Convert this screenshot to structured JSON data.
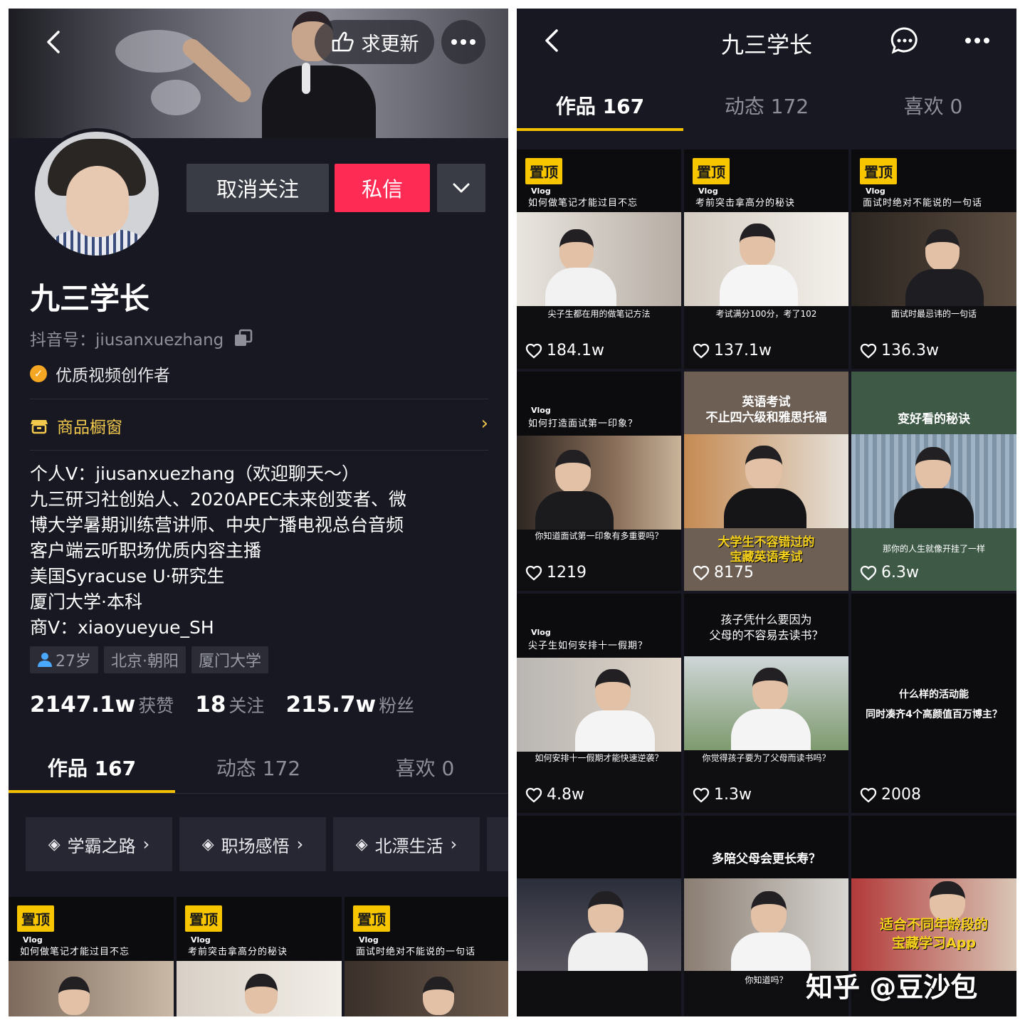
{
  "left": {
    "header": {
      "request_update_label": "求更新"
    },
    "buttons": {
      "unfollow": "取消关注",
      "message": "私信"
    },
    "profile": {
      "name": "九三学长",
      "douyin_id": "抖音号：jiusanxuezhang",
      "badge": "优质视频创作者",
      "shop_window": "商品橱窗",
      "bio": [
        "个人V：jiusanxuezhang（欢迎聊天～）",
        "九三研习社创始人、2020APEC未来创变者、微",
        "博大学暑期训练营讲师、中央广播电视总台音频",
        "客户端云听职场优质内容主播",
        "美国Syracuse U·研究生",
        "厦门大学·本科",
        "商V：xiaoyueyue_SH"
      ],
      "tags": [
        "27岁",
        "北京·朝阳",
        "厦门大学"
      ],
      "stats": [
        {
          "value": "2147.1w",
          "label": "获赞"
        },
        {
          "value": "18",
          "label": "关注"
        },
        {
          "value": "215.7w",
          "label": "粉丝"
        }
      ]
    },
    "tabs": [
      "作品 167",
      "动态 172",
      "喜欢 0"
    ],
    "collections": [
      "学霸之路",
      "职场感悟",
      "北漂生活"
    ],
    "videos": [
      {
        "pin": "置顶",
        "vlog": "Vlog",
        "title": "如何做笔记才能过目不忘"
      },
      {
        "pin": "置顶",
        "vlog": "Vlog",
        "title": "考前突击拿高分的秘诀"
      },
      {
        "pin": "置顶",
        "vlog": "Vlog",
        "title": "面试时绝对不能说的一句话"
      }
    ]
  },
  "right": {
    "header": {
      "title": "九三学长"
    },
    "tabs": [
      "作品 167",
      "动态 172",
      "喜欢 0"
    ],
    "videos": [
      {
        "pin": "置顶",
        "vlog": "Vlog",
        "title": "如何做笔记才能过目不忘",
        "caption": "尖子生都在用的做笔记方法",
        "likes": "184.1w"
      },
      {
        "pin": "置顶",
        "vlog": "Vlog",
        "title": "考前突击拿高分的秘诀",
        "caption": "考试满分100分，考了102",
        "likes": "137.1w"
      },
      {
        "pin": "置顶",
        "vlog": "Vlog",
        "title": "面试时绝对不能说的一句话",
        "caption": "面试时最忌讳的一句话",
        "likes": "136.3w"
      },
      {
        "vlog": "Vlog",
        "title": "如何打造面试第一印象？",
        "caption": "你知道面试第一印象有多重要吗？",
        "likes": "1219"
      },
      {
        "headline": [
          "英语考试",
          "不止四六级和雅思托福"
        ],
        "yellow": [
          "大学生不容错过的",
          "宝藏英语考试"
        ],
        "likes": "8175"
      },
      {
        "headline": [
          "变好看的秘诀"
        ],
        "caption": "那你的人生就像开挂了一样",
        "likes": "6.3w"
      },
      {
        "vlog": "Vlog",
        "title": "尖子生如何安排十一假期？",
        "caption": "如何安排十一假期才能快速逆袭？",
        "likes": "4.8w"
      },
      {
        "headline": [
          "孩子凭什么要因为",
          "父母的不容易去读书？"
        ],
        "caption": "你觉得孩子要为了父母而读书吗？",
        "likes": "1.3w"
      },
      {
        "headline": [
          "什么样的活动能",
          "同时凑齐4个高颜值百万博主？"
        ],
        "likes": "2008"
      },
      {
        "likes": ""
      },
      {
        "headline": [
          "多陪父母会更长寿？"
        ],
        "caption": "你知道吗？",
        "likes": ""
      },
      {
        "yellow": [
          "适合不同年龄段的",
          "宝藏学习App"
        ],
        "likes": ""
      }
    ]
  },
  "watermark": "知乎 @豆沙包",
  "colors": {
    "accent_yellow": "#f2c000",
    "message_red": "#fe2c55",
    "pin_yellow": "#f7c600",
    "background": "#171822"
  }
}
